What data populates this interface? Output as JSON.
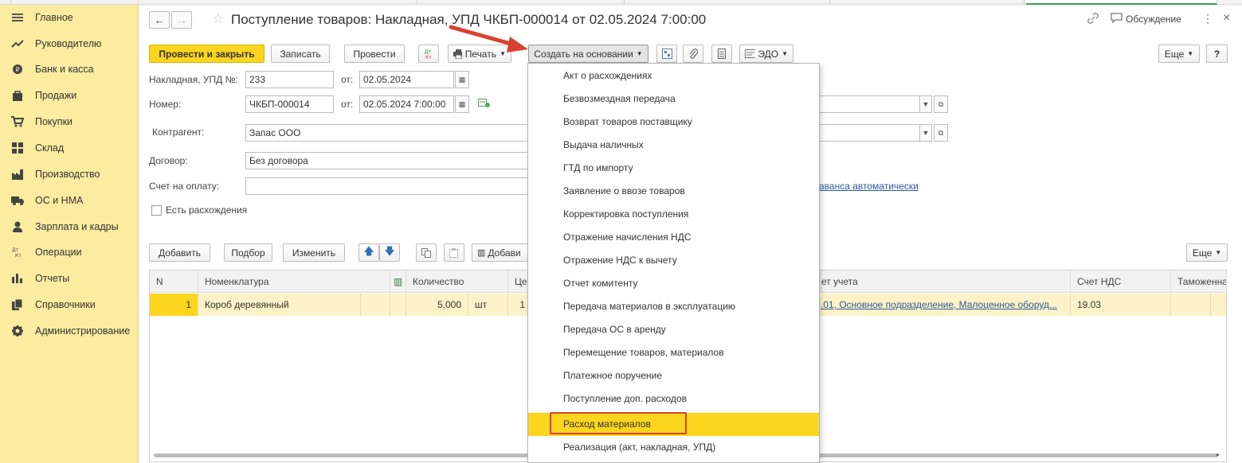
{
  "colors": {
    "sidebar_bg": "#fbeca0",
    "accent_yellow": "#fbd51e",
    "link": "#2d5b9e",
    "highlight_box": "#d9412f",
    "arrow": "#d9412f"
  },
  "sidebar": {
    "items": [
      {
        "label": "Главное",
        "icon": "menu-lines-icon"
      },
      {
        "label": "Руководителю",
        "icon": "trend-icon"
      },
      {
        "label": "Банк и касса",
        "icon": "coin-icon"
      },
      {
        "label": "Продажи",
        "icon": "bag-icon"
      },
      {
        "label": "Покупки",
        "icon": "cart-icon"
      },
      {
        "label": "Склад",
        "icon": "warehouse-icon"
      },
      {
        "label": "Производство",
        "icon": "factory-icon"
      },
      {
        "label": "ОС и НМА",
        "icon": "truck-icon"
      },
      {
        "label": "Зарплата и кадры",
        "icon": "person-icon"
      },
      {
        "label": "Операции",
        "icon": "dt-kt-icon"
      },
      {
        "label": "Отчеты",
        "icon": "bar-chart-icon"
      },
      {
        "label": "Справочники",
        "icon": "books-icon"
      },
      {
        "label": "Администрирование",
        "icon": "gear-icon"
      }
    ]
  },
  "header": {
    "title": "Поступление товаров: Накладная, УПД ЧКБП-000014 от 02.05.2024 7:00:00",
    "discussion": "Обсуждение",
    "more_menu": "⋮",
    "close": "×"
  },
  "toolbar": {
    "post_close": "Провести и закрыть",
    "save": "Записать",
    "post": "Провести",
    "dt_kt": "Дт Кт",
    "print": "Печать",
    "create_based": "Создать на основании",
    "edo": "ЭДО",
    "more": "Еще",
    "help": "?"
  },
  "form": {
    "invoice_label": "Накладная, УПД №:",
    "invoice_value": "233",
    "from_label_1": "от:",
    "invoice_date": "02.05.2024",
    "number_label": "Номер:",
    "number_value": "ЧКБП-000014",
    "from_label_2": "от:",
    "number_date": "02.05.2024  7:00:00",
    "counterparty_label": "Контрагент:",
    "counterparty_value": "Запас ООО",
    "contract_label": "Договор:",
    "contract_value": "Без договора",
    "invoice_pay_label": "Счет на оплату:",
    "invoice_pay_value": "",
    "discrepancy_label": "Есть расхождения",
    "advance_link": "аванса автоматически"
  },
  "table_toolbar": {
    "add": "Добавить",
    "pick": "Подбор",
    "change": "Изменить",
    "add_barcode": "Добави",
    "more": "Еще"
  },
  "table": {
    "columns": [
      "N",
      "Номенклатура",
      "Количество",
      "Це",
      "ет учета",
      "Счет НДС",
      "Таможенна"
    ],
    "rows": [
      {
        "n": "1",
        "item": "Короб деревянный",
        "qty": "5,000",
        "unit": "шт",
        "price": "1",
        "account": ".01, Основное подразделение, Малоценное оборуд...",
        "vat_account": "19.03",
        "customs": ""
      }
    ]
  },
  "dropdown": {
    "items": [
      "Акт о расхождениях",
      "Безвозмездная передача",
      "Возврат товаров поставщику",
      "Выдача наличных",
      "ГТД по импорту",
      "Заявление о ввозе товаров",
      "Корректировка поступления",
      "Отражение начисления НДС",
      "Отражение НДС к вычету",
      "Отчет комитенту",
      "Передача материалов в эксплуатацию",
      "Передача ОС в аренду",
      "Перемещение товаров, материалов",
      "Платежное поручение",
      "Поступление доп. расходов",
      "Расход материалов",
      "Реализация (акт, накладная, УПД)"
    ],
    "highlighted_index": 15
  }
}
